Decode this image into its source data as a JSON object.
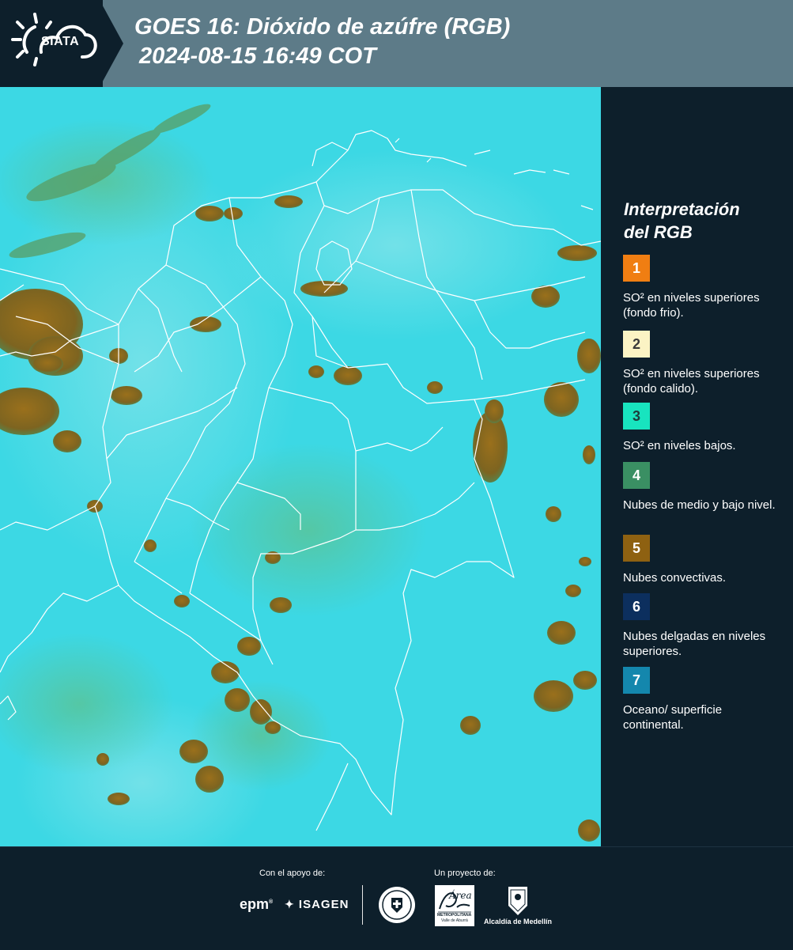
{
  "header": {
    "logo_text": "SIATA",
    "title_line1": "GOES 16: Dióxido de azúfre (RGB)",
    "title_line2": "2024-08-15 16:49 COT"
  },
  "legend": {
    "title_line1": "Interpretación",
    "title_line2": "del RGB",
    "items": [
      {
        "number": "1",
        "label": "SO² en niveles superiores (fondo frio).",
        "color": "#f07e12",
        "text_color": "#ffffff"
      },
      {
        "number": "2",
        "label": "SO² en niveles superiores (fondo calido).",
        "color": "#fbf3c4",
        "text_color": "#3a3a3a"
      },
      {
        "number": "3",
        "label": "SO² en niveles bajos.",
        "color": "#18e4bf",
        "text_color": "#1d3b3b"
      },
      {
        "number": "4",
        "label": "Nubes de medio y bajo nivel.",
        "color": "#3a8f63",
        "text_color": "#ffffff"
      },
      {
        "number": "5",
        "label": "Nubes convectivas.",
        "color": "#8e6111",
        "text_color": "#ffffff"
      },
      {
        "number": "6",
        "label": "Nubes delgadas en niveles superiores.",
        "color": "#0c2f5e",
        "text_color": "#ffffff"
      },
      {
        "number": "7",
        "label": "Oceano/ superficie continental.",
        "color": "#1487ad",
        "text_color": "#ffffff"
      }
    ]
  },
  "footer": {
    "support_label": "Con el apoyo de:",
    "project_label": "Un proyecto de:",
    "sponsor1": "epm",
    "sponsor2": "ISAGEN",
    "partner1": "METROPOLITANA",
    "partner1_sub": "Valle de Aburrá",
    "partner1_script": "Área",
    "partner2": "Alcaldía de Medellín"
  },
  "map": {
    "ocean_color": "#3cd8e4",
    "cloud_color": "#8e6a1c",
    "border_color": "#ffffff"
  }
}
